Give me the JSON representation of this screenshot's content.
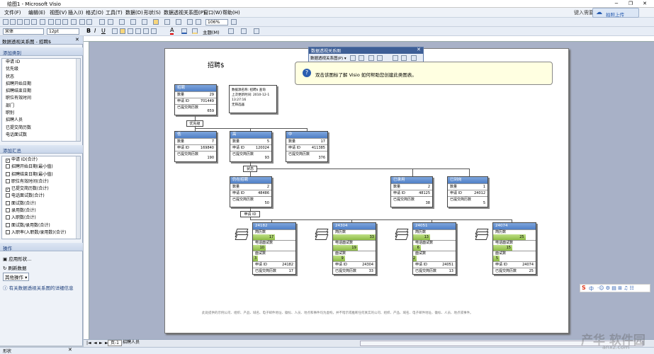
{
  "window": {
    "title": "绘图1 - Microsoft Visio",
    "minimize": "−",
    "restore": "❐",
    "close": "✕"
  },
  "menu": [
    "文件(F)",
    "编辑(E)",
    "视图(V)",
    "插入(I)",
    "格式(O)",
    "工具(T)",
    "数据(D)",
    "形状(S)",
    "数据透视关系图(P)",
    "窗口(W)",
    "帮助(H)"
  ],
  "help_box": "键入需要帮助的问题",
  "cloud": {
    "label": "拍照上传"
  },
  "toolbar": {
    "zoom": "106%",
    "font": "宋体",
    "size": "12pt",
    "theme": "主题(M)"
  },
  "panel": {
    "title": "数据透视关系图 - 招聘$",
    "add_category_title": "添加类别",
    "categories": [
      "申请 ID",
      "优先级",
      "状态",
      "招聘开始日期",
      "招聘结束日期",
      "职位有效时间",
      "部门",
      "职别",
      "招聘人员",
      "已提交简历数",
      "电话面试数"
    ],
    "add_summary_title": "添加汇总",
    "summaries": [
      {
        "label": "申请 ID(合计)",
        "checked": "✓"
      },
      {
        "label": "招聘开始日期(最小值)",
        "checked": ""
      },
      {
        "label": "招聘结束日期(最小值)",
        "checked": ""
      },
      {
        "label": "职位有效时间(合计)",
        "checked": ""
      },
      {
        "label": "已提交简历数(合计)",
        "checked": "✓"
      },
      {
        "label": "电话面试数(合计)",
        "checked": ""
      },
      {
        "label": "面试数(合计)",
        "checked": ""
      },
      {
        "label": "录用数(合计)",
        "checked": ""
      },
      {
        "label": "入职数(合计)",
        "checked": ""
      },
      {
        "label": "面试数/录用数(合计)",
        "checked": ""
      },
      {
        "label": "入职率(入职数/录用数)(合计)",
        "checked": ""
      }
    ],
    "ops_title": "操作",
    "ops": [
      "应用形状...",
      "刷新数据",
      "其他操作 ▾"
    ],
    "info": "有关数据透视关系图的详细信息"
  },
  "float_toolbar": {
    "title": "数据透视关系图",
    "menu": "数据透视关系图(P) ▾"
  },
  "tooltip": "双击该图标了解 Visio 如何帮助您创建此类图表。",
  "diagram": {
    "title": "招聘$",
    "info_box": [
      "数据源名称: 招聘$ 查询",
      "上次更新时间: 2010-12-1 13:27:16",
      "无筛选器"
    ],
    "root": {
      "name": "招聘",
      "rows": [
        [
          "数量",
          "29"
        ],
        [
          "申请 ID",
          "701449"
        ],
        [
          "已提交简历数",
          "659"
        ]
      ]
    },
    "label_priority": "优先级",
    "level1": [
      {
        "name": "低",
        "rows": [
          [
            "数量",
            "7"
          ],
          [
            "申请 ID",
            "169840"
          ],
          [
            "已提交简历数",
            "190"
          ]
        ]
      },
      {
        "name": "高",
        "rows": [
          [
            "数量",
            "5"
          ],
          [
            "申请 ID",
            "120024"
          ],
          [
            "已提交简历数",
            "93"
          ]
        ]
      },
      {
        "name": "中",
        "rows": [
          [
            "数量",
            "17"
          ],
          [
            "申请 ID",
            "411385"
          ],
          [
            "已提交简历数",
            "376"
          ]
        ]
      }
    ],
    "label_status": "状态",
    "level2": [
      {
        "name": "仍在招聘",
        "rows": [
          [
            "数量",
            "2"
          ],
          [
            "申请 ID",
            "48486"
          ],
          [
            "已提交简历数",
            "50"
          ]
        ]
      },
      {
        "name": "已录用",
        "rows": [
          [
            "数量",
            "2"
          ],
          [
            "申请 ID",
            "48125"
          ],
          [
            "已提交简历数",
            "38"
          ]
        ]
      },
      {
        "name": "已到岗",
        "rows": [
          [
            "数量",
            "1"
          ],
          [
            "申请 ID",
            "24012"
          ],
          [
            "已提交简历数",
            "5"
          ]
        ]
      }
    ],
    "label_id": "申请 ID",
    "leaf_labels": {
      "a": "简历数",
      "b": "电话面试数",
      "c": "面试数",
      "id": "申请 ID",
      "resumes": "已提交简历数"
    },
    "leaves": [
      {
        "id": "24182",
        "a": "17",
        "b": "10",
        "c": "3",
        "rid": "24182",
        "r": "17"
      },
      {
        "id": "24304",
        "a": "33",
        "b": "19",
        "c": "9",
        "rid": "24304",
        "r": "33"
      },
      {
        "id": "24051",
        "a": "13",
        "b": "6",
        "c": "2",
        "rid": "24051",
        "r": "13"
      },
      {
        "id": "24074",
        "a": "25",
        "b": "15",
        "c": "5",
        "rid": "24074",
        "r": "25"
      }
    ],
    "footer": "此处提供的示例公司、组织、产品、域名、电子邮件地址、徽标、人员、地点和事件均为虚构，并不暗示或推断任何真实的公司、组织、产品、域名、电子邮件地址、徽标、人员、地点或事件。"
  },
  "bottom": {
    "tabs": [
      "页-1",
      "招聘人员"
    ],
    "nav": [
      "|◄",
      "◄",
      "►",
      "►|"
    ]
  },
  "status": {
    "text": "形状"
  },
  "ime": {
    "label": "中"
  },
  "watermark": {
    "text": "产华 软件园",
    "sub": "anxz.com"
  }
}
